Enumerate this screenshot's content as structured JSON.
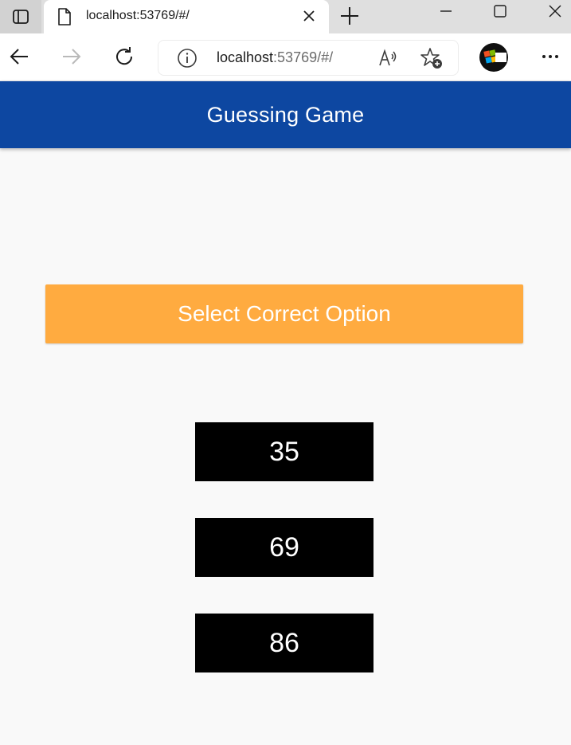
{
  "browser": {
    "tab_title": "localhost:53769/#/",
    "url_host": "localhost",
    "url_rest": ":53769/#/",
    "icons": [
      "tab-actions-icon",
      "page-icon",
      "close-icon",
      "plus-icon",
      "minimize-icon",
      "maximize-icon",
      "window-close-icon",
      "back-arrow-icon",
      "forward-arrow-icon",
      "refresh-icon",
      "info-icon",
      "read-aloud-icon",
      "favorites-add-icon",
      "profile-avatar",
      "more-dots-icon"
    ]
  },
  "app": {
    "title": "Guessing Game",
    "prompt": "Select Correct Option",
    "options": [
      "35",
      "69",
      "86"
    ],
    "colors": {
      "app_bar": "#0d47a1",
      "prompt_banner": "#ffab40",
      "option_button": "#000000",
      "background": "#f9f9f9"
    }
  }
}
